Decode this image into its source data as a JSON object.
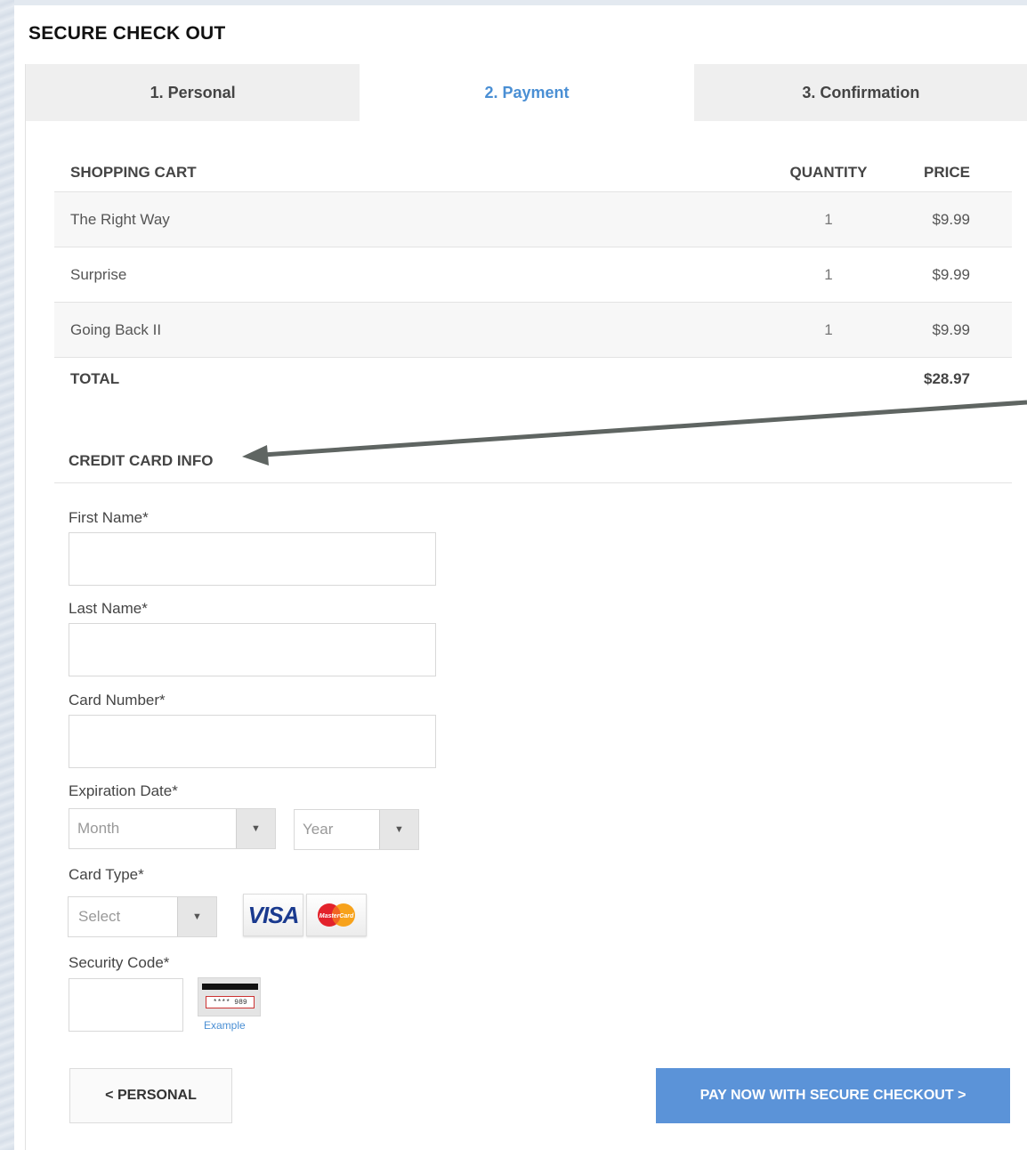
{
  "page": {
    "title": "SECURE CHECK OUT"
  },
  "tabs": [
    {
      "label": "1. Personal"
    },
    {
      "label": "2. Payment"
    },
    {
      "label": "3. Confirmation"
    }
  ],
  "cart": {
    "headers": {
      "name": "SHOPPING CART",
      "quantity": "QUANTITY",
      "price": "PRICE"
    },
    "items": [
      {
        "name": "The Right Way",
        "quantity": "1",
        "price": "$9.99"
      },
      {
        "name": "Surprise",
        "quantity": "1",
        "price": "$9.99"
      },
      {
        "name": "Going Back II",
        "quantity": "1",
        "price": "$9.99"
      }
    ],
    "total_label": "TOTAL",
    "total_value": "$28.97"
  },
  "credit_card": {
    "section_title": "CREDIT CARD INFO",
    "first_name_label": "First Name*",
    "last_name_label": "Last Name*",
    "card_number_label": "Card Number*",
    "expiration_label": "Expiration Date*",
    "month_value": "Month",
    "year_value": "Year",
    "card_type_label": "Card Type*",
    "card_type_value": "Select",
    "visa_text": "VISA",
    "mastercard_text": "MasterCard",
    "security_code_label": "Security Code*",
    "cvv_sample": "**** 989",
    "cvv_example_link": "Example"
  },
  "buttons": {
    "back_label": "< PERSONAL",
    "pay_label": "PAY NOW WITH SECURE CHECKOUT >"
  },
  "colors": {
    "accent": "#4a8fd4",
    "pay_button": "#5b93d8",
    "tab_inactive": "#efefef"
  }
}
